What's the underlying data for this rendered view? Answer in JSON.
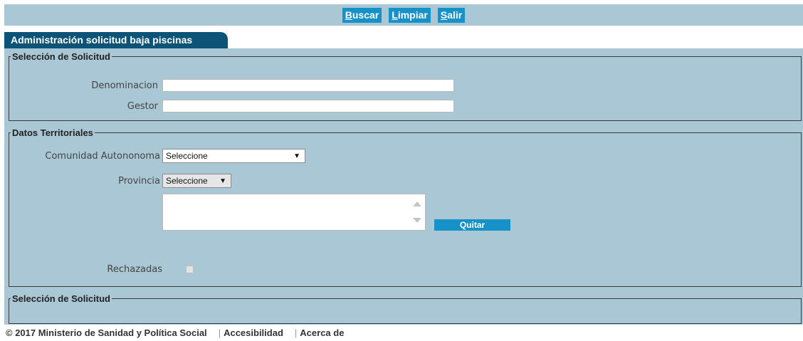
{
  "toolbar": {
    "buscar_first": "B",
    "buscar_rest": "uscar",
    "limpiar_first": "L",
    "limpiar_rest": "impiar",
    "salir_first": "S",
    "salir_rest": "alir"
  },
  "tab": {
    "title": "Administración solicitud baja piscinas"
  },
  "seleccion": {
    "legend": "Selección de Solicitud",
    "denominacion_label": "Denominacion",
    "denominacion_value": "",
    "gestor_label": "Gestor",
    "gestor_value": ""
  },
  "territorial": {
    "legend": "Datos Territoriales",
    "comunidad_label": "Comunidad Autononoma",
    "comunidad_value": "Seleccione",
    "provincia_label": "Provincia",
    "provincia_value": "Seleccione",
    "quitar_label": "Quitar",
    "rechazadas_label": "Rechazadas",
    "rechazadas_checked": false
  },
  "seleccion2": {
    "legend": "Selección de Solicitud"
  },
  "footer": {
    "copyright": "© 2017 Ministerio de Sanidad y Política Social",
    "accesibilidad": "Accesibilidad",
    "acerca": "Acerca de"
  },
  "colors": {
    "panel_bg": "#a9c7d4",
    "button_bg": "#1792c8",
    "tab_bg": "#0b5478"
  }
}
